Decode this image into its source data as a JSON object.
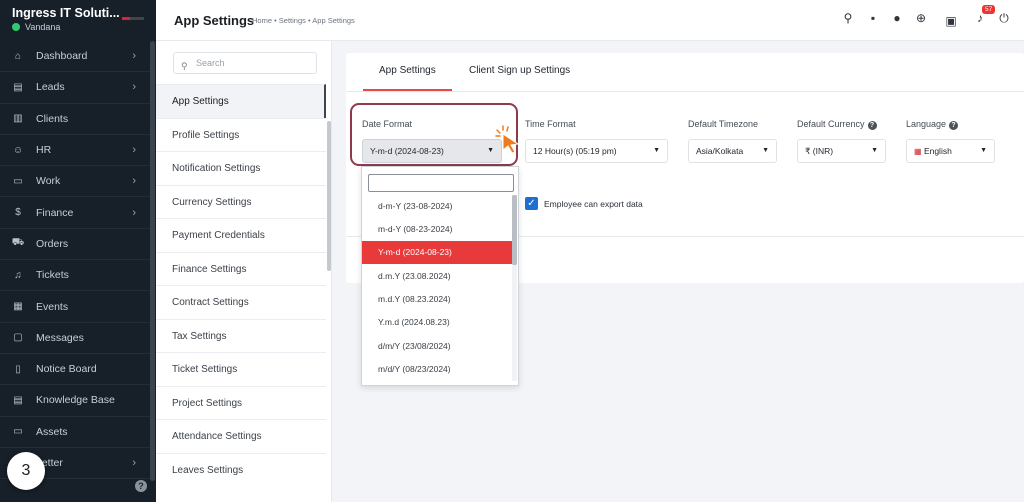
{
  "sidebar": {
    "brand": "Ingress IT Soluti...",
    "user": "Vandana",
    "items": [
      {
        "label": "Dashboard",
        "icon": "home-icon",
        "chevron": true
      },
      {
        "label": "Leads",
        "icon": "id-card-icon",
        "chevron": true
      },
      {
        "label": "Clients",
        "icon": "chart-icon",
        "chevron": false
      },
      {
        "label": "HR",
        "icon": "users-icon",
        "chevron": true
      },
      {
        "label": "Work",
        "icon": "briefcase-icon",
        "chevron": true
      },
      {
        "label": "Finance",
        "icon": "dollar-icon",
        "chevron": true
      },
      {
        "label": "Orders",
        "icon": "cart-icon",
        "chevron": false
      },
      {
        "label": "Tickets",
        "icon": "headset-icon",
        "chevron": false
      },
      {
        "label": "Events",
        "icon": "calendar-icon",
        "chevron": false
      },
      {
        "label": "Messages",
        "icon": "message-icon",
        "chevron": false
      },
      {
        "label": "Notice Board",
        "icon": "clipboard-icon",
        "chevron": false
      },
      {
        "label": "Knowledge Base",
        "icon": "book-icon",
        "chevron": false
      },
      {
        "label": "Assets",
        "icon": "monitor-icon",
        "chevron": false
      },
      {
        "label": "Letter",
        "icon": "letter-icon",
        "chevron": true
      }
    ],
    "step_badge": "3"
  },
  "header": {
    "title": "App Settings",
    "breadcrumb": "Home • Settings • App Settings",
    "notification_count": "57"
  },
  "settings_menu": {
    "search_placeholder": "Search",
    "items": [
      "App Settings",
      "Profile Settings",
      "Notification Settings",
      "Currency Settings",
      "Payment Credentials",
      "Finance Settings",
      "Contract Settings",
      "Tax Settings",
      "Ticket Settings",
      "Project Settings",
      "Attendance Settings",
      "Leaves Settings"
    ]
  },
  "tabs": [
    "App Settings",
    "Client Sign up Settings"
  ],
  "fields": {
    "date_format": {
      "label": "Date Format",
      "value": "Y-m-d (2024-08-23)"
    },
    "time_format": {
      "label": "Time Format",
      "value": "12 Hour(s) (05:19 pm)"
    },
    "timezone": {
      "label": "Default Timezone",
      "value": "Asia/Kolkata"
    },
    "currency": {
      "label": "Default Currency",
      "value": "₹ (INR)"
    },
    "language": {
      "label": "Language",
      "value": "English"
    }
  },
  "export_checkbox": "Employee can export data",
  "date_options": [
    "d-m-Y (23-08-2024)",
    "m-d-Y (08-23-2024)",
    "Y-m-d (2024-08-23)",
    "d.m.Y (23.08.2024)",
    "m.d.Y (08.23.2024)",
    "Y.m.d (2024.08.23)",
    "d/m/Y (23/08/2024)",
    "m/d/Y (08/23/2024)"
  ]
}
